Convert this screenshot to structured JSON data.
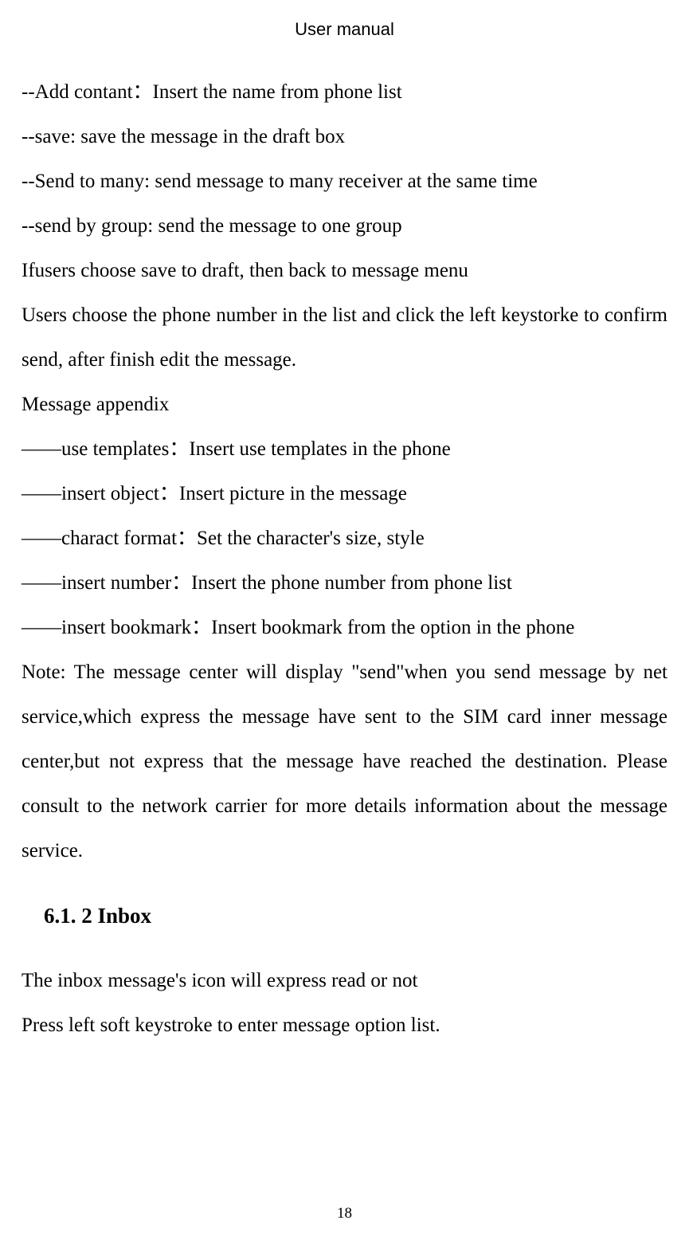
{
  "header": {
    "title": "User manual"
  },
  "body": {
    "lines": [
      "--Add contant：Insert the name from phone list",
      "--save: save the message in the draft box",
      "--Send to many: send message to many receiver at the same time",
      "--send by group: send the message to one group",
      "Ifusers choose save to draft, then back to message menu",
      "Users choose the phone number in the list and click the left keystorke to confirm send, after finish edit the message.",
      "Message appendix",
      "――use templates：Insert use templates in the phone",
      "――insert  object：Insert picture in the message",
      "――charact format：Set the character's size, style",
      "――insert number：Insert the phone number from phone list",
      "――insert bookmark：Insert bookmark from the option in the phone",
      "Note: The message center will display \"send\"when you send message by net service,which express the message have sent to the SIM card inner message center,but not express that the message have reached the destination. Please consult to the network carrier for more details information about the message service."
    ],
    "heading": "6.1. 2 Inbox",
    "lines2": [
      "The inbox message's icon will express read or not",
      "Press left soft keystroke to enter message option list."
    ]
  },
  "footer": {
    "page_number": "18"
  }
}
